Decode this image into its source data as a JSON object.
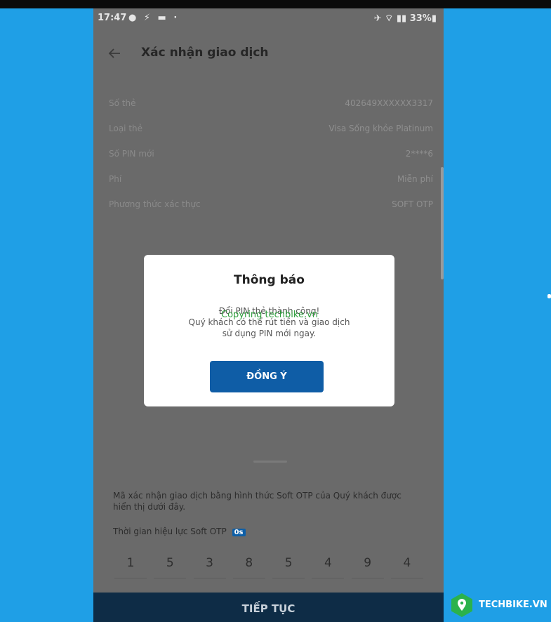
{
  "status_bar": {
    "time": "17:47",
    "left_icons": "● ⚡ ▬ ·",
    "right_icons": "✈ ⌔ ▮▮ 33%▮"
  },
  "header": {
    "title": "Xác nhận giao dịch"
  },
  "info_rows": [
    {
      "label": "Số thẻ",
      "value": "402649XXXXXX3317"
    },
    {
      "label": "Loại thẻ",
      "value": "Visa Sống khỏe Platinum"
    },
    {
      "label": "Số PIN mới",
      "value": "2****6"
    },
    {
      "label": "Phí",
      "value": "Miễn phí"
    },
    {
      "label": "Phương thức xác thực",
      "value": "SOFT OTP"
    }
  ],
  "dialog": {
    "title": "Thông báo",
    "message_lines": [
      "Đổi PIN thẻ thành công!",
      "Quý khách có thể rút tiền và giao dịch",
      "sử dụng PIN mới ngay."
    ],
    "watermark": "Copyring techbike.vn",
    "ok_label": "ĐỒNG Ý"
  },
  "otp": {
    "description": "Mã xác nhận giao dịch bằng hình thức Soft OTP của Quý khách được hiển thị dưới đây.",
    "time_label": "Thời gian hiệu lực Soft OTP",
    "time_value": "0s",
    "digits": [
      "1",
      "5",
      "3",
      "8",
      "5",
      "4",
      "9",
      "4"
    ]
  },
  "continue_label": "TIẾP TỤC",
  "logo": {
    "text": "TECHBIKE.VN",
    "color": "#2bb24c"
  },
  "colors": {
    "background": "#1f9fe6",
    "primary_button": "#0f5da6",
    "continue_bar": "#0e2c46"
  }
}
